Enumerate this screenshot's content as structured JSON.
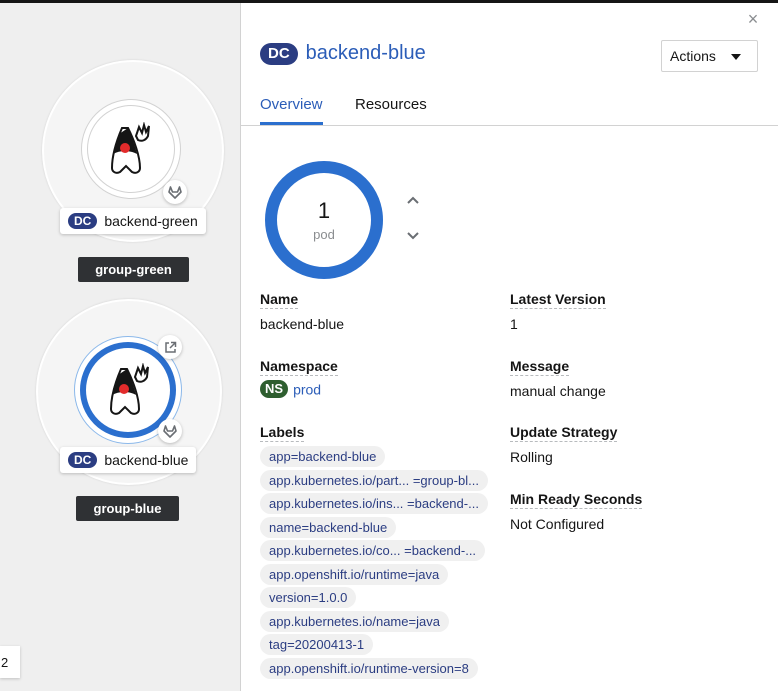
{
  "topology": {
    "nodes": [
      {
        "kind": "DC",
        "name": "backend-green",
        "group": "group-green"
      },
      {
        "kind": "DC",
        "name": "backend-blue",
        "group": "group-blue"
      }
    ],
    "zoom_indicator": "2"
  },
  "panel": {
    "close_glyph": "×",
    "kind_badge": "DC",
    "title": "backend-blue",
    "actions_label": "Actions",
    "tabs": [
      {
        "label": "Overview",
        "active": true
      },
      {
        "label": "Resources",
        "active": false
      }
    ],
    "pods": {
      "count": "1",
      "unit": "pod"
    },
    "details": {
      "name_label": "Name",
      "name_value": "backend-blue",
      "namespace_label": "Namespace",
      "namespace_badge": "NS",
      "namespace_value": "prod",
      "labels_label": "Labels",
      "labels": [
        "app=backend-blue",
        "app.kubernetes.io/part... =group-bl...",
        "app.kubernetes.io/ins... =backend-...",
        "name=backend-blue",
        "app.kubernetes.io/co...   =backend-...",
        "app.openshift.io/runtime=java",
        "version=1.0.0",
        "app.kubernetes.io/name=java",
        "tag=20200413-1",
        "app.openshift.io/runtime-version=8"
      ],
      "latest_version_label": "Latest Version",
      "latest_version_value": "1",
      "message_label": "Message",
      "message_value": "manual change",
      "update_strategy_label": "Update Strategy",
      "update_strategy_value": "Rolling",
      "min_ready_label": "Min Ready Seconds",
      "min_ready_value": "Not Configured"
    }
  },
  "colors": {
    "accent_blue": "#2b6fce",
    "dc_badge": "#2b3d82",
    "ns_badge": "#2e5e2f",
    "group_label_bg": "#2f3134"
  }
}
